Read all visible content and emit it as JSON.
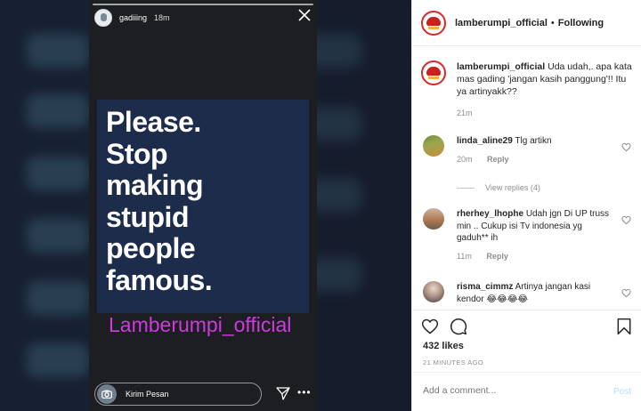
{
  "story": {
    "username": "gadiiing",
    "time": "18m",
    "card_lines": [
      "Please.",
      "Stop",
      "making",
      "stupid",
      "people",
      "famous."
    ],
    "overlay_text": "Lamberumpi_official",
    "reply_placeholder": "Kirim Pesan"
  },
  "post": {
    "account": "lamberumpi_official",
    "separator": "•",
    "follow_status": "Following",
    "caption": {
      "user": "lamberumpi_official",
      "text": "Uda udah,. apa kata mas gading 'jangan kasih panggung'!! Itu ya artinyakk??",
      "time": "21m"
    },
    "comments": [
      {
        "user": "linda_aline29",
        "text": "Tlg artikn",
        "time": "20m",
        "reply": "Reply"
      },
      {
        "user": "rherhey_lhophe",
        "text": "Udah jgn Di UP truss min .. Cukup isi Tv indonesia yg gaduh** ih",
        "time": "11m",
        "reply": "Reply"
      },
      {
        "user": "risma_cimmz",
        "text": "Artinya jangan kasi kendor 😂😂😂😂"
      }
    ],
    "view_replies": "View replies (4)",
    "likes": "432 likes",
    "ago": "21 MINUTES AGO",
    "add_comment_placeholder": "Add a comment...",
    "post_label": "Post"
  },
  "colors": {
    "story_card": "#1c2c4a",
    "overlay_text": "#cc3bdc",
    "post_button": "#b2dffc"
  },
  "icons": [
    "close-icon",
    "camera-icon",
    "send-icon",
    "more-icon",
    "heart-icon",
    "comment-icon",
    "bookmark-icon"
  ]
}
